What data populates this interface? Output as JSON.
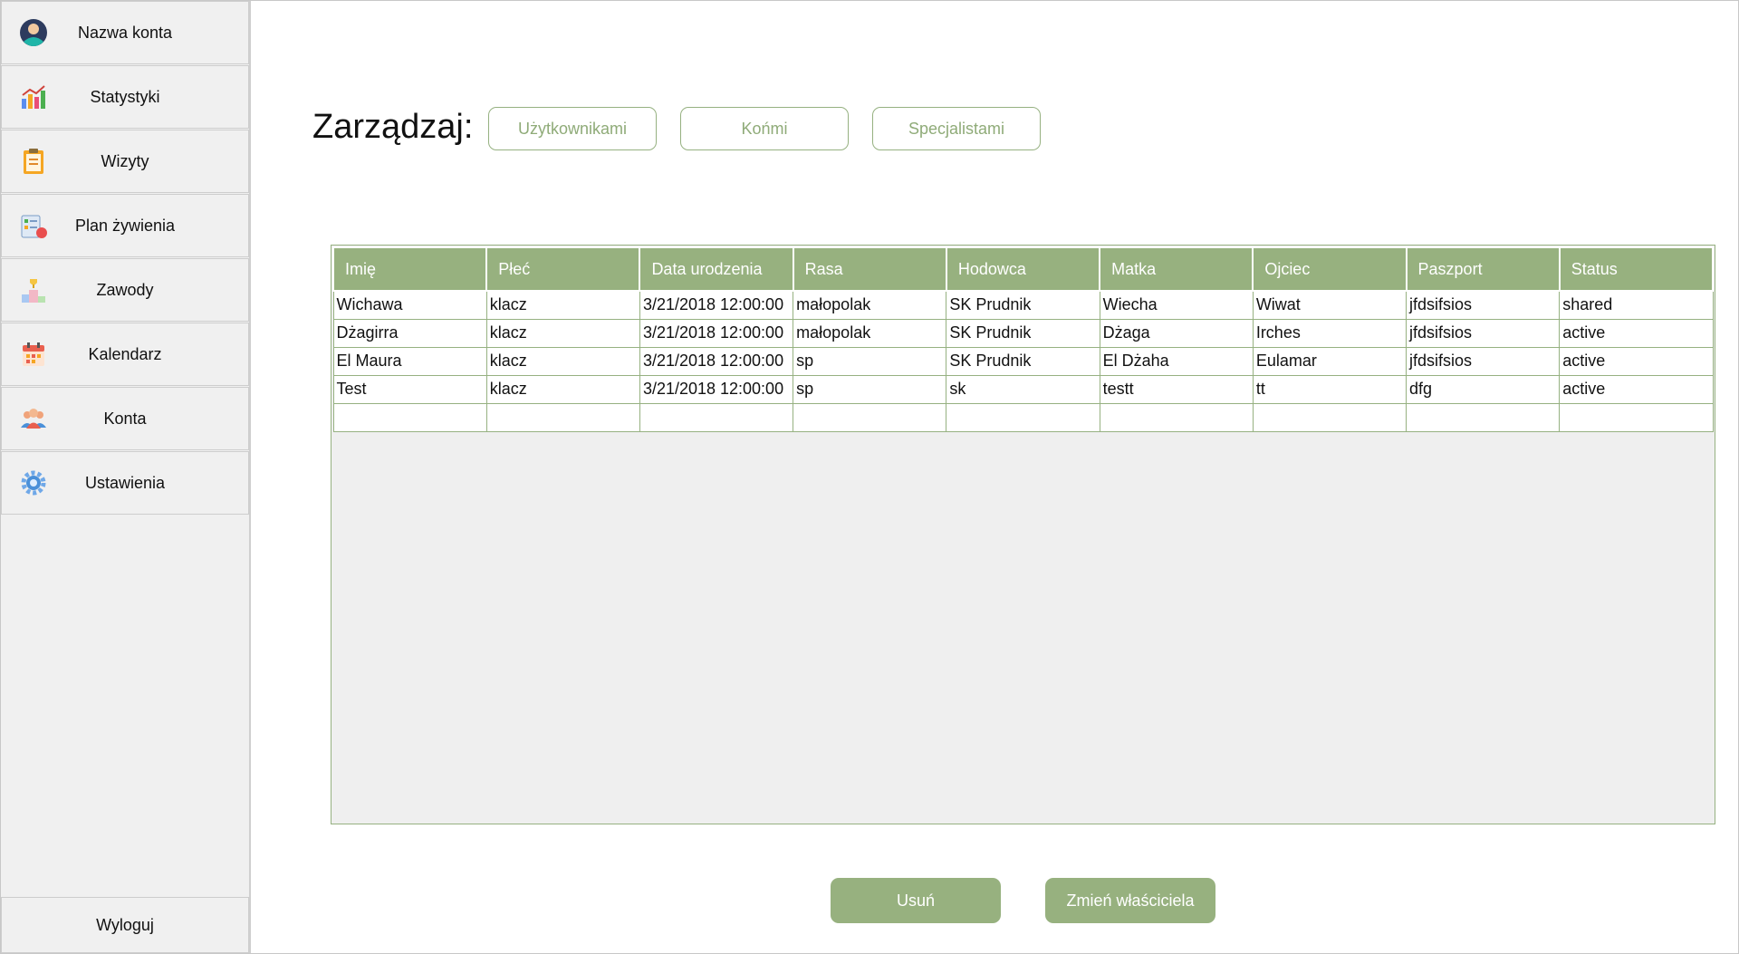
{
  "sidebar": {
    "items": [
      {
        "label": "Nazwa konta",
        "icon": "user-avatar-icon"
      },
      {
        "label": "Statystyki",
        "icon": "bar-chart-icon"
      },
      {
        "label": "Wizyty",
        "icon": "clipboard-icon"
      },
      {
        "label": "Plan żywienia",
        "icon": "meal-plan-icon"
      },
      {
        "label": "Zawody",
        "icon": "podium-trophy-icon"
      },
      {
        "label": "Kalendarz",
        "icon": "calendar-icon"
      },
      {
        "label": "Konta",
        "icon": "users-group-icon"
      },
      {
        "label": "Ustawienia",
        "icon": "gear-icon"
      }
    ],
    "logout_label": "Wyloguj"
  },
  "manage": {
    "label": "Zarządzaj:",
    "buttons": [
      "Użytkownikami",
      "Końmi",
      "Specjalistami"
    ]
  },
  "table": {
    "columns": [
      "Imię",
      "Płeć",
      "Data urodzenia",
      "Rasa",
      "Hodowca",
      "Matka",
      "Ojciec",
      "Paszport",
      "Status"
    ],
    "rows": [
      [
        "Wichawa",
        "klacz",
        "3/21/2018 12:00:00",
        "małopolak",
        "SK Prudnik",
        "Wiecha",
        "Wiwat",
        "jfdsifsios",
        "shared"
      ],
      [
        "Dżagirra",
        "klacz",
        "3/21/2018 12:00:00",
        "małopolak",
        "SK Prudnik",
        "Dżaga",
        "Irches",
        "jfdsifsios",
        "active"
      ],
      [
        "El Maura",
        "klacz",
        "3/21/2018 12:00:00",
        "sp",
        "SK Prudnik",
        "El Dżaha",
        "Eulamar",
        "jfdsifsios",
        "active"
      ],
      [
        "Test",
        "klacz",
        "3/21/2018 12:00:00",
        "sp",
        "sk",
        "testt",
        "tt",
        "dfg",
        "active"
      ],
      [
        "",
        "",
        "",
        "",
        "",
        "",
        "",
        "",
        ""
      ]
    ]
  },
  "actions": {
    "delete_label": "Usuń",
    "change_owner_label": "Zmień właściciela"
  },
  "colors": {
    "accent": "#97b17f",
    "sidebar_bg": "#f0f0f0",
    "grid_bg": "#efefef"
  }
}
